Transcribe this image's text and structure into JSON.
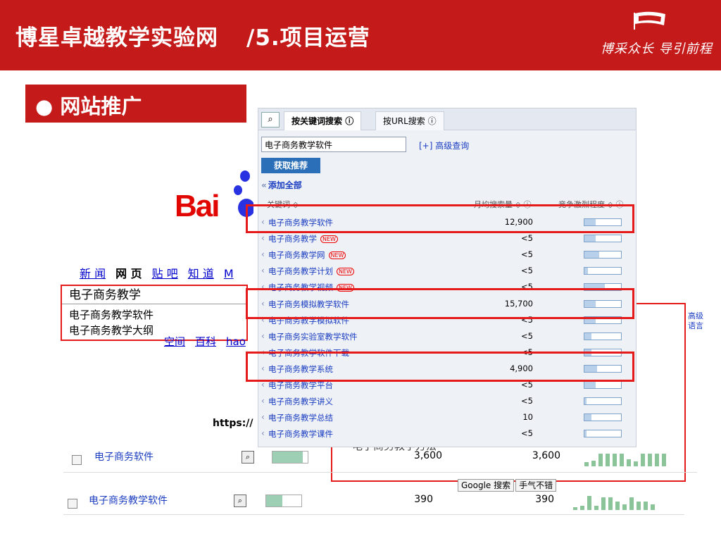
{
  "header": {
    "title": "博星卓越教学实验网",
    "subtitle": "/5.项目运营",
    "slogan": "博采众长 导引前程",
    "bg_color": "#c41a1a"
  },
  "section": {
    "label": "● 网站推广"
  },
  "baidu": {
    "logo": "Bai",
    "nav": [
      "新 闻",
      "网 页",
      "贴 吧",
      "知 道",
      "M"
    ],
    "query": "电子商务教学",
    "suggestions": [
      "电子商务教学软件",
      "电子商务教学大纲"
    ],
    "bottom_links": [
      "空间",
      "百科",
      "hao"
    ],
    "url_prefix": "https://"
  },
  "google_rows": [
    {
      "keyword": "电子商务软件",
      "vol_local": "3,600",
      "vol_global": "3,600",
      "bar": 0.85,
      "trend": [
        0.3,
        0.4,
        0.9,
        0.9,
        0.9,
        0.9,
        0.5,
        0.35,
        0.9,
        0.9,
        0.9,
        0.9
      ]
    },
    {
      "keyword": "电子商务教学软件",
      "vol_local": "390",
      "vol_global": "390",
      "bar": 0.45,
      "trend": [
        0.2,
        0.3,
        1.0,
        0.3,
        0.9,
        0.9,
        0.6,
        0.4,
        0.9,
        0.6,
        0.6,
        0.4
      ]
    }
  ],
  "google": {
    "partial_text": "电子商务教学方法",
    "buttons": [
      "Google 搜索",
      "手气不错"
    ],
    "side_links": [
      "高级",
      "语言"
    ]
  },
  "tool": {
    "tabs": [
      "按关键词搜索",
      "按URL搜索"
    ],
    "query": "电子商务教学软件",
    "advanced": "[+] 高级查询",
    "get_button": "获取推荐",
    "add_all": "添加全部",
    "col_keyword": "关键词 ◇",
    "col_volume": "月均搜索量 ◇ ⓘ",
    "col_comp": "竞争激烈程度 ◇ ⓘ",
    "new_badge": "NEW",
    "rows": [
      {
        "kw": "电子商务教学软件",
        "vol": "12,900",
        "comp": 0.3,
        "new": false
      },
      {
        "kw": "电子商务教学",
        "vol": "<5",
        "comp": 0.3,
        "new": true
      },
      {
        "kw": "电子商务教学网",
        "vol": "<5",
        "comp": 0.4,
        "new": true
      },
      {
        "kw": "电子商务教学计划",
        "vol": "<5",
        "comp": 0.1,
        "new": true
      },
      {
        "kw": "电子商务教学视频",
        "vol": "<5",
        "comp": 0.55,
        "new": true
      },
      {
        "kw": "电子商务模拟教学软件",
        "vol": "15,700",
        "comp": 0.3,
        "new": false
      },
      {
        "kw": "电子商务教学模拟软件",
        "vol": "<5",
        "comp": 0.3,
        "new": false
      },
      {
        "kw": "电子商务实验室教学软件",
        "vol": "<5",
        "comp": 0.2,
        "new": false
      },
      {
        "kw": "电子商务教学软件下载",
        "vol": "<5",
        "comp": 0.2,
        "new": false
      },
      {
        "kw": "电子商务教学系统",
        "vol": "4,900",
        "comp": 0.35,
        "new": false
      },
      {
        "kw": "电子商务教学平台",
        "vol": "<5",
        "comp": 0.3,
        "new": false
      },
      {
        "kw": "电子商务教学讲义",
        "vol": "<5",
        "comp": 0.05,
        "new": false
      },
      {
        "kw": "电子商务教学总结",
        "vol": "10",
        "comp": 0.2,
        "new": false
      },
      {
        "kw": "电子商务教学课件",
        "vol": "<5",
        "comp": 0.05,
        "new": false
      }
    ]
  }
}
